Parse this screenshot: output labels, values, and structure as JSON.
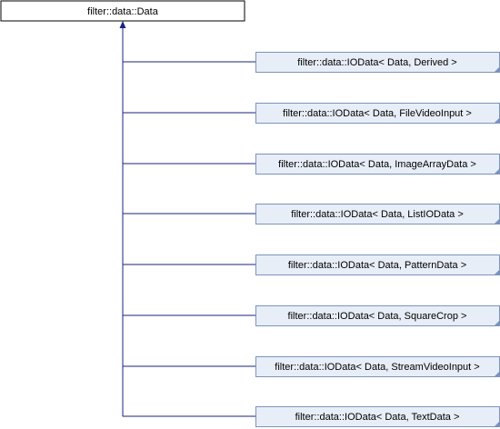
{
  "diagram": {
    "base_class": "filter::data::Data",
    "derived_classes": [
      "filter::data::IOData< Data, Derived >",
      "filter::data::IOData< Data, FileVideoInput >",
      "filter::data::IOData< Data, ImageArrayData >",
      "filter::data::IOData< Data, ListIOData >",
      "filter::data::IOData< Data, PatternData >",
      "filter::data::IOData< Data, SquareCrop >",
      "filter::data::IOData< Data, StreamVideoInput >",
      "filter::data::IOData< Data, TextData >"
    ],
    "colors": {
      "base_fill": "#ffffff",
      "derived_fill": "#e8eef7",
      "derived_border": "#7b93bd",
      "base_border": "#000000",
      "edge": "#1a237e"
    }
  }
}
